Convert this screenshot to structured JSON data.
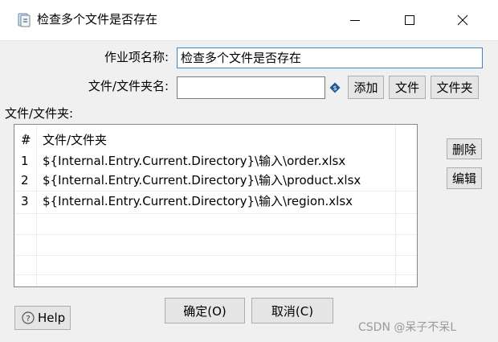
{
  "window": {
    "title": "检查多个文件是否存在"
  },
  "form": {
    "job_name_label": "作业项名称:",
    "job_name_value": "检查多个文件是否存在",
    "file_label": "文件/文件夹名:",
    "file_value": "",
    "add_label": "添加",
    "file_button_label": "文件",
    "folder_button_label": "文件夹",
    "files_section_label": "文件/文件夹:"
  },
  "table": {
    "columns": [
      "#",
      "文件/文件夹"
    ],
    "rows": [
      {
        "index": "1",
        "path": "${Internal.Entry.Current.Directory}\\输入\\order.xlsx"
      },
      {
        "index": "2",
        "path": "${Internal.Entry.Current.Directory}\\输入\\product.xlsx"
      },
      {
        "index": "3",
        "path": "${Internal.Entry.Current.Directory}\\输入\\region.xlsx"
      }
    ]
  },
  "side_buttons": {
    "delete_label": "删除",
    "edit_label": "编辑"
  },
  "footer": {
    "help_label": "Help",
    "ok_label": "确定(O)",
    "cancel_label": "取消(C)"
  },
  "watermark": "CSDN @呆子不呆L",
  "icons": {
    "app": "kettle-job-icon",
    "variable": "variable-diamond-icon",
    "help": "question-circle-icon",
    "sort": "sort-caret-icon"
  },
  "colors": {
    "window_bg": "#f0f0f0",
    "focus_border": "#3b83cc",
    "variable_icon": "#1e5799"
  }
}
